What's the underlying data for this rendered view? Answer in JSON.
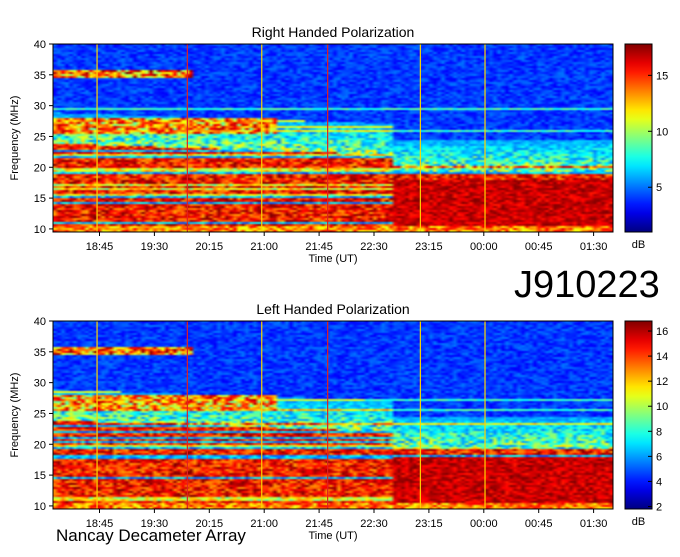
{
  "observation_id": "J910223",
  "footer_label": "Nancay Decameter Array",
  "chart_data": [
    {
      "type": "heatmap",
      "title": "Right Handed Polarization",
      "xlabel": "Time (UT)",
      "ylabel": "Frequency (MHz)",
      "x_ticks": [
        "18:45",
        "19:30",
        "20:15",
        "21:00",
        "21:45",
        "22:30",
        "23:15",
        "00:00",
        "00:45",
        "01:30"
      ],
      "y_ticks": [
        10,
        15,
        20,
        25,
        30,
        35,
        40
      ],
      "ylim": [
        9.5,
        40
      ],
      "colorbar": {
        "unit": "dB",
        "ticks": [
          5,
          10,
          15
        ],
        "range": [
          1,
          17.8
        ]
      },
      "colormap": "jet",
      "events": [
        {
          "x": "18:43",
          "color": "#ffd400"
        },
        {
          "x": "19:57",
          "color": "#e02020"
        },
        {
          "x": "20:58",
          "color": "#ffd400"
        },
        {
          "x": "21:52",
          "color": "#e02020"
        },
        {
          "x": "23:08",
          "color": "#ffd400"
        },
        {
          "x": "00:01",
          "color": "#ffd400"
        }
      ]
    },
    {
      "type": "heatmap",
      "title": "Left Handed Polarization",
      "xlabel": "Time (UT)",
      "ylabel": "Frequency (MHz)",
      "x_ticks": [
        "18:45",
        "19:30",
        "20:15",
        "21:00",
        "21:45",
        "22:30",
        "23:15",
        "00:00",
        "00:45",
        "01:30"
      ],
      "y_ticks": [
        10,
        15,
        20,
        25,
        30,
        35,
        40
      ],
      "ylim": [
        9.5,
        40
      ],
      "colorbar": {
        "unit": "dB",
        "ticks": [
          2,
          4,
          6,
          8,
          10,
          12,
          14,
          16
        ],
        "range": [
          1.8,
          16.8
        ]
      },
      "colormap": "jet",
      "events": [
        {
          "x": "18:43",
          "color": "#ffd400"
        },
        {
          "x": "19:57",
          "color": "#e02020"
        },
        {
          "x": "20:58",
          "color": "#ffd400"
        },
        {
          "x": "21:52",
          "color": "#e02020"
        },
        {
          "x": "23:08",
          "color": "#ffd400"
        },
        {
          "x": "00:01",
          "color": "#ffd400"
        }
      ]
    }
  ]
}
